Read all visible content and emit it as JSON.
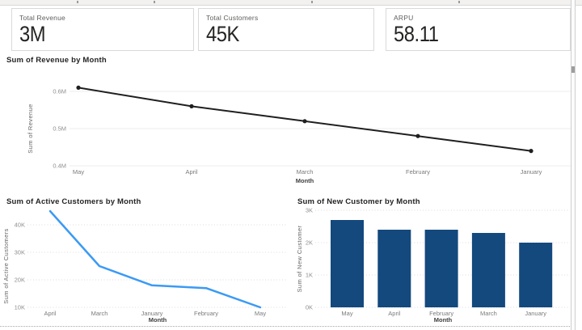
{
  "cards": [
    {
      "label": "Total Revenue",
      "value": "3M"
    },
    {
      "label": "Total Customers",
      "value": "45K"
    },
    {
      "label": "ARPU",
      "value": "58.11"
    }
  ],
  "chart_data": [
    {
      "type": "line",
      "title": "Sum of Revenue by Month",
      "xlabel": "Month",
      "ylabel": "Sum of Revenue",
      "categories": [
        "May",
        "April",
        "March",
        "February",
        "January"
      ],
      "values": [
        0.61,
        0.56,
        0.52,
        0.48,
        0.44
      ],
      "value_unit": "M",
      "yticks": [
        {
          "label": "0.6M",
          "value": 0.6
        },
        {
          "label": "0.5M",
          "value": 0.5
        },
        {
          "label": "0.4M",
          "value": 0.4
        }
      ],
      "ylim": [
        0.4,
        0.65
      ],
      "grid": "solid",
      "legend": "none",
      "line_color": "#1f1f1f",
      "markers": true
    },
    {
      "type": "line",
      "title": "Sum of Active Customers by Month",
      "xlabel": "Month",
      "ylabel": "Sum of Active Customers",
      "categories": [
        "April",
        "March",
        "January",
        "February",
        "May"
      ],
      "values": [
        45,
        25,
        18,
        17,
        10
      ],
      "value_unit": "K",
      "yticks": [
        {
          "label": "40K",
          "value": 40
        },
        {
          "label": "30K",
          "value": 30
        },
        {
          "label": "20K",
          "value": 20
        },
        {
          "label": "10K",
          "value": 10
        }
      ],
      "ylim": [
        10,
        46
      ],
      "grid": "dotted",
      "legend": "none",
      "line_color": "#3b9af4",
      "markers": false
    },
    {
      "type": "bar",
      "title": "Sum of New Customer by Month",
      "xlabel": "Month",
      "ylabel": "Sum of New Customer",
      "categories": [
        "May",
        "April",
        "February",
        "March",
        "January"
      ],
      "values": [
        2.7,
        2.4,
        2.4,
        2.3,
        2.0
      ],
      "value_unit": "K",
      "yticks": [
        {
          "label": "3K",
          "value": 3
        },
        {
          "label": "2K",
          "value": 2
        },
        {
          "label": "1K",
          "value": 1
        },
        {
          "label": "0K",
          "value": 0
        }
      ],
      "ylim": [
        0,
        3
      ],
      "grid": "dotted",
      "legend": "none",
      "bar_color": "#13497d"
    }
  ],
  "colors": {
    "accent_blue": "#3b9af4",
    "bar_navy": "#13497d",
    "line_black": "#1f1f1f",
    "card_border": "#d9d9d9",
    "title_text": "#252423",
    "muted_text": "#605e5c"
  }
}
